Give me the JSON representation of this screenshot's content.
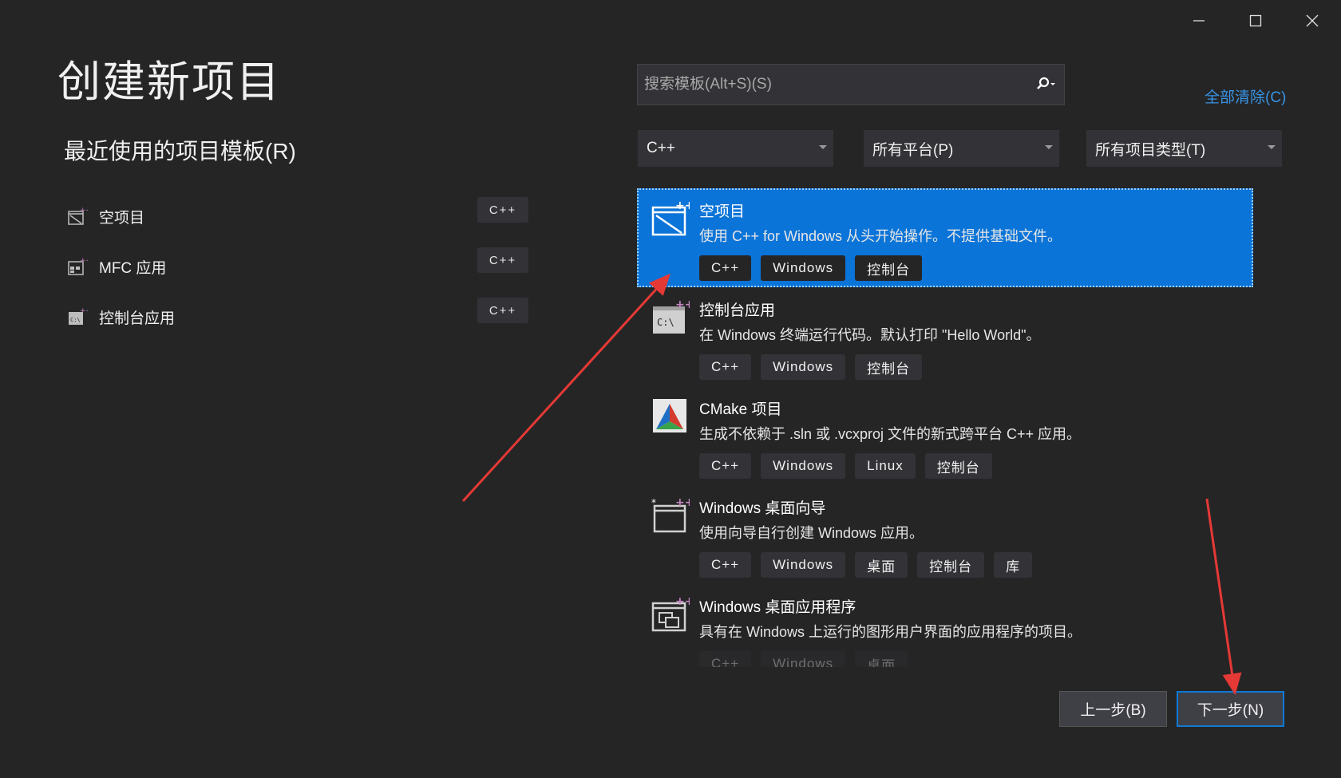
{
  "window": {
    "title": "创建新项目"
  },
  "recent": {
    "heading": "最近使用的项目模板(R)",
    "items": [
      {
        "label": "空项目",
        "tag": "C++",
        "icon": "empty-project-icon"
      },
      {
        "label": "MFC 应用",
        "tag": "C++",
        "icon": "mfc-app-icon"
      },
      {
        "label": "控制台应用",
        "tag": "C++",
        "icon": "console-app-icon"
      }
    ]
  },
  "search": {
    "placeholder": "搜索模板(Alt+S)(S)"
  },
  "clear_all": "全部清除(C)",
  "filters": {
    "language": "C++",
    "platform": "所有平台(P)",
    "project_type": "所有项目类型(T)"
  },
  "templates": [
    {
      "name": "空项目",
      "desc": "使用 C++ for Windows 从头开始操作。不提供基础文件。",
      "tags": [
        "C++",
        "Windows",
        "控制台"
      ],
      "icon": "empty-project-icon",
      "selected": true
    },
    {
      "name": "控制台应用",
      "desc": "在 Windows 终端运行代码。默认打印 \"Hello World\"。",
      "tags": [
        "C++",
        "Windows",
        "控制台"
      ],
      "icon": "console-app-icon"
    },
    {
      "name": "CMake 项目",
      "desc": "生成不依赖于 .sln 或 .vcxproj 文件的新式跨平台 C++ 应用。",
      "tags": [
        "C++",
        "Windows",
        "Linux",
        "控制台"
      ],
      "icon": "cmake-icon"
    },
    {
      "name": "Windows 桌面向导",
      "desc": "使用向导自行创建 Windows 应用。",
      "tags": [
        "C++",
        "Windows",
        "桌面",
        "控制台",
        "库"
      ],
      "icon": "desktop-wizard-icon"
    },
    {
      "name": "Windows 桌面应用程序",
      "desc": "具有在 Windows 上运行的图形用户界面的应用程序的项目。",
      "tags": [
        "C++",
        "Windows",
        "桌面"
      ],
      "icon": "desktop-app-icon"
    }
  ],
  "buttons": {
    "back": "上一步(B)",
    "next": "下一步(N)"
  },
  "colors": {
    "background": "#252526",
    "accent": "#0b74d8",
    "link": "#3794e5",
    "annotation": "#e53935"
  }
}
